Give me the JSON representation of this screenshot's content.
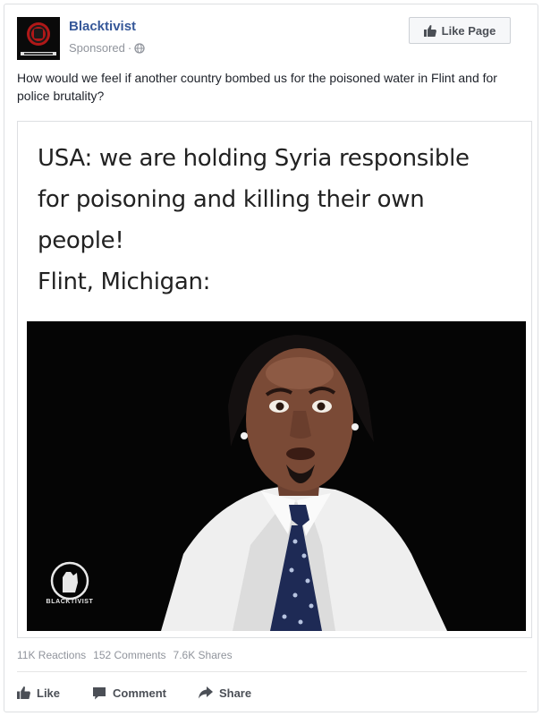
{
  "header": {
    "page_name": "Blacktivist",
    "sponsored": "Sponsored",
    "separator": "·",
    "like_page": "Like Page"
  },
  "post": {
    "text": "How would we feel if another country bombed us for the poisoned water in Flint and for police brutality?"
  },
  "meme": {
    "line1": "USA: we are holding Syria responsible",
    "line2": "for poisoning and killing their own",
    "line3": "people!",
    "line4": "Flint, Michigan:",
    "watermark": "BLACKTIVIST"
  },
  "stats": {
    "reactions": "11K Reactions",
    "comments": "152 Comments",
    "shares": "7.6K Shares"
  },
  "actions": {
    "like": "Like",
    "comment": "Comment",
    "share": "Share"
  },
  "icons": {
    "like_page": "thumbs-up-icon",
    "audience": "globe-icon",
    "like": "thumbs-up-icon",
    "comment": "comment-bubble-icon",
    "share": "share-arrow-icon"
  },
  "colors": {
    "link_blue": "#365899",
    "meta_gray": "#90949c",
    "action_gray": "#4b4f56",
    "border": "#dddfe2"
  }
}
